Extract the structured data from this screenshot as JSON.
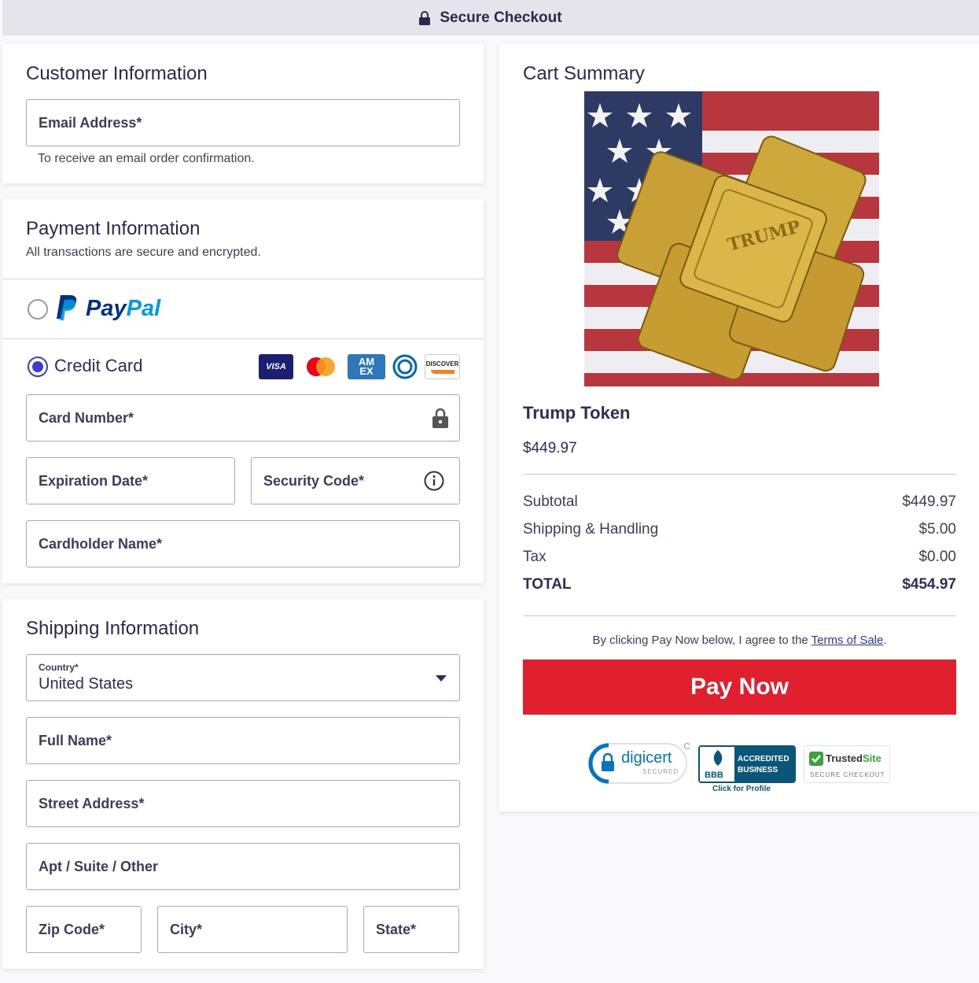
{
  "header": {
    "title": "Secure Checkout"
  },
  "customer": {
    "title": "Customer Information",
    "email_label": "Email Address*",
    "email_hint": "To receive an email order confirmation."
  },
  "payment": {
    "title": "Payment Information",
    "subtitle": "All transactions are secure and encrypted.",
    "paypal_label": "PayPal",
    "credit_card_label": "Credit Card",
    "card_brands": [
      "VISA",
      "Mastercard",
      "AMEX",
      "Diners Club",
      "DISCOVER"
    ],
    "card_number_label": "Card Number*",
    "expiration_label": "Expiration Date*",
    "security_code_label": "Security Code*",
    "cardholder_label": "Cardholder Name*",
    "selected_method": "Credit Card"
  },
  "shipping": {
    "title": "Shipping Information",
    "country_label": "Country*",
    "country_value": "United States",
    "full_name_label": "Full Name*",
    "street_label": "Street Address*",
    "apt_label": "Apt / Suite / Other",
    "zip_label": "Zip Code*",
    "city_label": "City*",
    "state_label": "State*"
  },
  "cart": {
    "title": "Cart Summary",
    "product_name": "Trump Token",
    "product_price": "$449.97",
    "subtotal_label": "Subtotal",
    "subtotal_value": "$449.97",
    "shipping_label": "Shipping & Handling",
    "shipping_value": "$5.00",
    "tax_label": "Tax",
    "tax_value": "$0.00",
    "total_label": "TOTAL",
    "total_value": "$454.97",
    "agree_text": "By clicking Pay Now below, I agree to the ",
    "terms_link": "Terms of Sale",
    "agree_end": ".",
    "pay_button": "Pay Now"
  },
  "badges": {
    "digicert": "digicert",
    "digicert_sub": "SECURED",
    "bbb_line1": "ACCREDITED",
    "bbb_line2": "BUSINESS",
    "bbb_mark": "BBB",
    "bbb_click": "Click for Profile",
    "trusted_a": "Trusted",
    "trusted_b": "Site",
    "trusted_sub": "SECURE CHECKOUT"
  },
  "colors": {
    "accent": "#3b3bcc",
    "pay_button": "#e0202e",
    "text": "#2d2d55",
    "paypal_dark": "#003087",
    "paypal_light": "#009cde"
  }
}
